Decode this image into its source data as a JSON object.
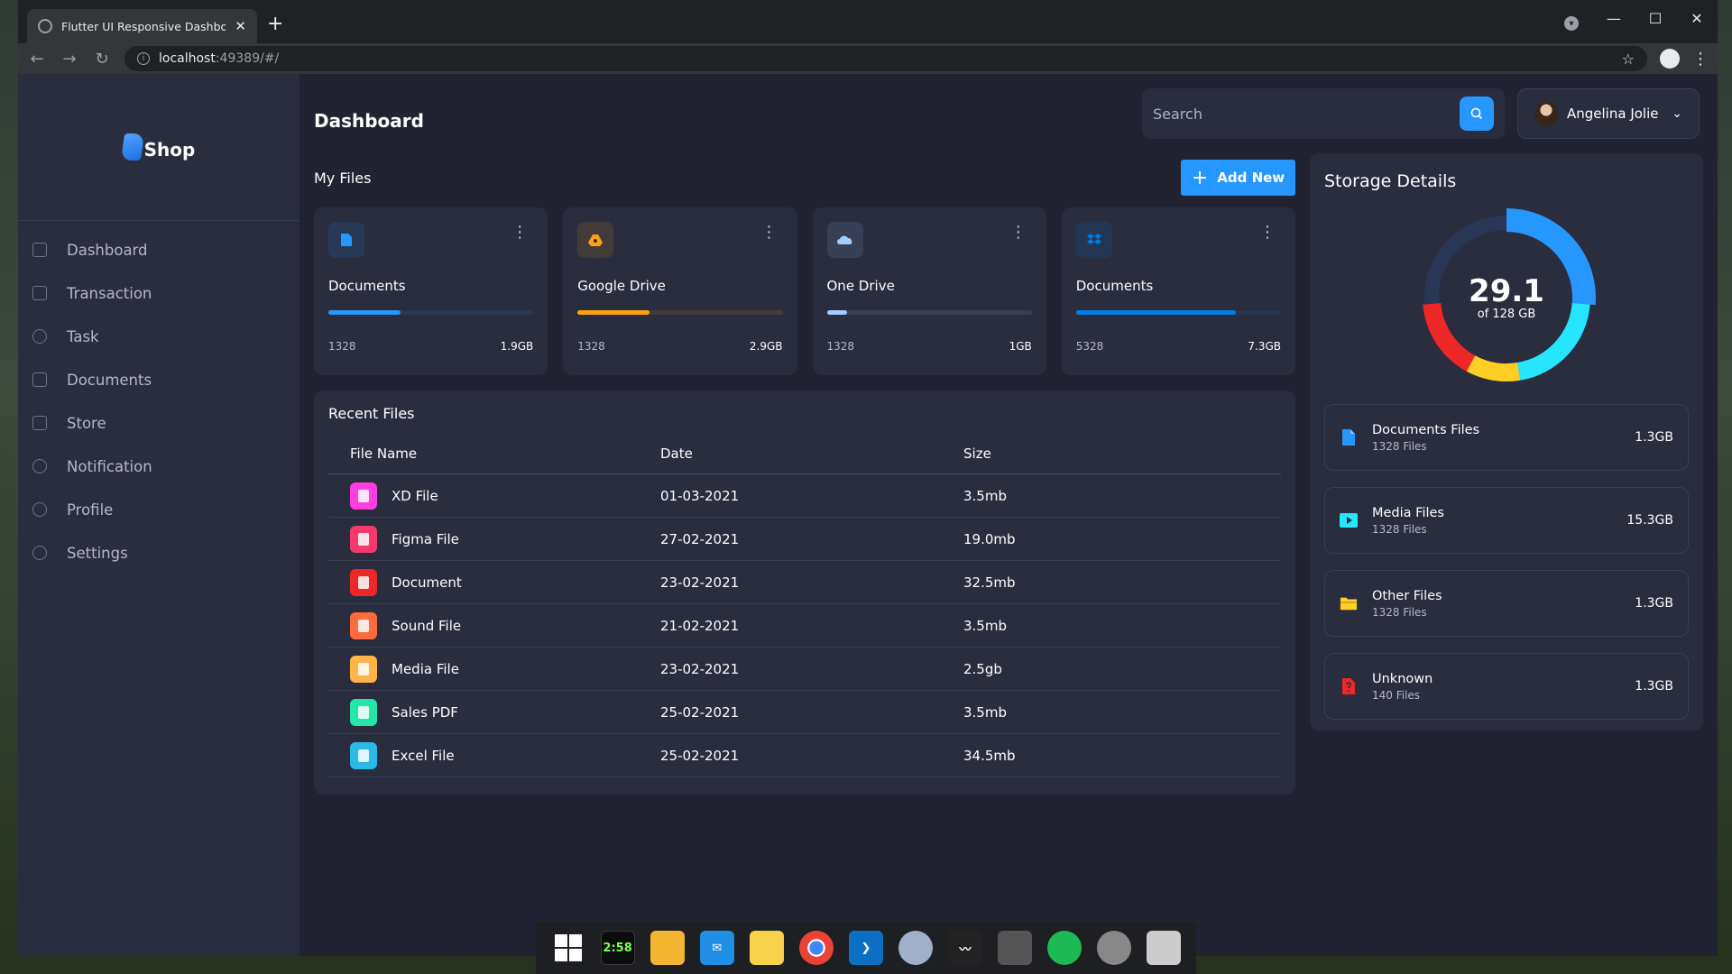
{
  "browser": {
    "tab_title": "Flutter UI Responsive Dashboard",
    "url_host": "localhost",
    "url_rest": ":49389/#/"
  },
  "sidebar": {
    "logo_text": "Shop",
    "items": [
      {
        "label": "Dashboard",
        "icon": "dashboard-icon"
      },
      {
        "label": "Transaction",
        "icon": "transaction-icon"
      },
      {
        "label": "Task",
        "icon": "task-icon"
      },
      {
        "label": "Documents",
        "icon": "documents-icon"
      },
      {
        "label": "Store",
        "icon": "store-icon"
      },
      {
        "label": "Notification",
        "icon": "notification-icon"
      },
      {
        "label": "Profile",
        "icon": "profile-icon"
      },
      {
        "label": "Settings",
        "icon": "settings-icon"
      }
    ]
  },
  "header": {
    "title": "Dashboard",
    "search_placeholder": "Search",
    "user_name": "Angelina Jolie"
  },
  "my_files": {
    "title": "My Files",
    "add_label": "Add New",
    "cards": [
      {
        "name": "Documents",
        "count": "1328",
        "size": "1.9GB",
        "percent": 35,
        "color": "#2697ff",
        "icon": "document-icon"
      },
      {
        "name": "Google Drive",
        "count": "1328",
        "size": "2.9GB",
        "percent": 35,
        "color": "#ffa113",
        "icon": "google-drive-icon"
      },
      {
        "name": "One Drive",
        "count": "1328",
        "size": "1GB",
        "percent": 10,
        "color": "#a4cdff",
        "icon": "one-drive-icon"
      },
      {
        "name": "Documents",
        "count": "5328",
        "size": "7.3GB",
        "percent": 78,
        "color": "#007ee5",
        "icon": "dropbox-icon"
      }
    ]
  },
  "recent_files": {
    "title": "Recent Files",
    "columns": [
      "File Name",
      "Date",
      "Size"
    ],
    "rows": [
      {
        "name": "XD File",
        "date": "01-03-2021",
        "size": "3.5mb",
        "color": "#ff3fe0"
      },
      {
        "name": "Figma File",
        "date": "27-02-2021",
        "size": "19.0mb",
        "color": "#f73a6b"
      },
      {
        "name": "Document",
        "date": "23-02-2021",
        "size": "32.5mb",
        "color": "#ee2727"
      },
      {
        "name": "Sound File",
        "date": "21-02-2021",
        "size": "3.5mb",
        "color": "#ff6b3d"
      },
      {
        "name": "Media File",
        "date": "23-02-2021",
        "size": "2.5gb",
        "color": "#ffb547"
      },
      {
        "name": "Sales PDF",
        "date": "25-02-2021",
        "size": "3.5mb",
        "color": "#26e5a8"
      },
      {
        "name": "Excel File",
        "date": "25-02-2021",
        "size": "34.5mb",
        "color": "#2bb9e8"
      }
    ]
  },
  "storage": {
    "title": "Storage Details",
    "used": "29.1",
    "total_label": "of 128 GB",
    "segments": [
      {
        "color": "#2697ff",
        "value": 25
      },
      {
        "color": "#26e5ff",
        "value": 20
      },
      {
        "color": "#ffcf26",
        "value": 10
      },
      {
        "color": "#ee2727",
        "value": 15
      },
      {
        "color": "#2a3656",
        "value": 25
      }
    ],
    "items": [
      {
        "name": "Documents Files",
        "count": "1328 Files",
        "size": "1.3GB",
        "color": "#2697ff",
        "icon": "document-file-icon"
      },
      {
        "name": "Media Files",
        "count": "1328 Files",
        "size": "15.3GB",
        "color": "#26e5ff",
        "icon": "media-file-icon"
      },
      {
        "name": "Other Files",
        "count": "1328 Files",
        "size": "1.3GB",
        "color": "#ffcf26",
        "icon": "folder-icon"
      },
      {
        "name": "Unknown",
        "count": "140 Files",
        "size": "1.3GB",
        "color": "#ee2727",
        "icon": "unknown-file-icon"
      }
    ]
  },
  "taskbar": {
    "clock": "2:58",
    "apps": [
      "windows-start-icon",
      "clock-app-icon",
      "file-explorer-icon",
      "mail-icon",
      "notes-icon",
      "chrome-icon",
      "vscode-icon",
      "app-eye-icon",
      "activity-monitor-icon",
      "game-icon",
      "spotify-icon",
      "settings-app-icon",
      "cloud-app-icon"
    ]
  }
}
